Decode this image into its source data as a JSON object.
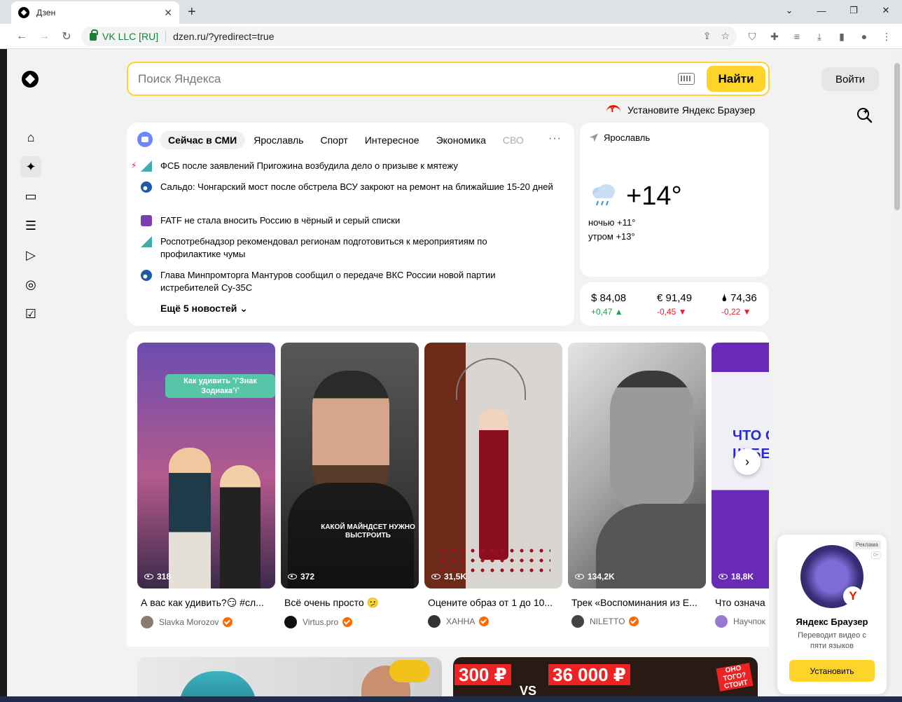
{
  "browser": {
    "tab_title": "Дзен",
    "tab_close": "✕",
    "new_tab": "+",
    "org_label": "VK LLC [RU]",
    "url": "dzen.ru/?yredirect=true"
  },
  "search": {
    "placeholder": "Поиск Яндекса",
    "button_label": "Найти"
  },
  "header": {
    "login_label": "Войти",
    "install_browser_label": "Установите Яндекс Браузер"
  },
  "news": {
    "tabs": [
      "Сейчас в СМИ",
      "Ярославль",
      "Спорт",
      "Интересное",
      "Экономика",
      "СВО"
    ],
    "more_icon": "···",
    "items": [
      "ФСБ после заявлений Пригожина возбудила дело о призыве к мятежу",
      "Сальдо: Чонгарский мост после обстрела ВСУ закроют на ремонт на ближайшие 15-20 дней",
      "FATF не стала вносить Россию в чёрный и серый списки",
      "Роспотребнадзор рекомендовал регионам подготовиться к мероприятиям по профилактике чумы",
      "Глава Минпромторга Мантуров сообщил о передаче ВКС России новой партии истребителей Су-35С"
    ],
    "more_label": "Ещё 5 новостей"
  },
  "weather": {
    "location": "Ярославль",
    "temp": "+14°",
    "night": "ночью +11°",
    "morning": "утром +13°"
  },
  "currency": [
    {
      "value": "$ 84,08",
      "delta": "+0,47 ▲",
      "trend": "up"
    },
    {
      "value": "€ 91,49",
      "delta": "-0,45 ▼",
      "trend": "down"
    },
    {
      "value": "🌢 74,36",
      "delta": "-0,22 ▼",
      "trend": "down"
    }
  ],
  "shorts": [
    {
      "views": "318",
      "title": "А вас как удивить?😏 #сл...",
      "author": "Slavka Morozov",
      "overlay": "Как удивить ♈Знак Зодиака♈"
    },
    {
      "views": "372",
      "title": "Всё очень просто 🫤",
      "author": "Virtus.pro",
      "overlay": "КАКОЙ МАЙНДСЕТ НУЖНО ВЫСТРОИТЬ"
    },
    {
      "views": "31,5K",
      "title": "Оцените образ от 1 до 10...",
      "author": "ХАННА"
    },
    {
      "views": "134,2K",
      "title": "Трек «Воспоминания из Е...",
      "author": "NILETTO"
    },
    {
      "views": "18,8K",
      "title": "Что означа",
      "author": "Научпок",
      "overlay": "ЧТО О Щ БЕ"
    }
  ],
  "bottom_cards": {
    "price_a": "300 ₽",
    "vs": "VS",
    "price_b": "36 000 ₽",
    "sticker": "ОНО ТОГО? СТОИТ"
  },
  "ad": {
    "tag": "Реклама",
    "age": "0+",
    "title": "Яндекс Браузер",
    "description": "Переводит видео с пяти языков",
    "button_label": "Установить"
  },
  "colors": {
    "accent": "#fed42b",
    "up": "#1aa24a",
    "down": "#e3222a"
  }
}
